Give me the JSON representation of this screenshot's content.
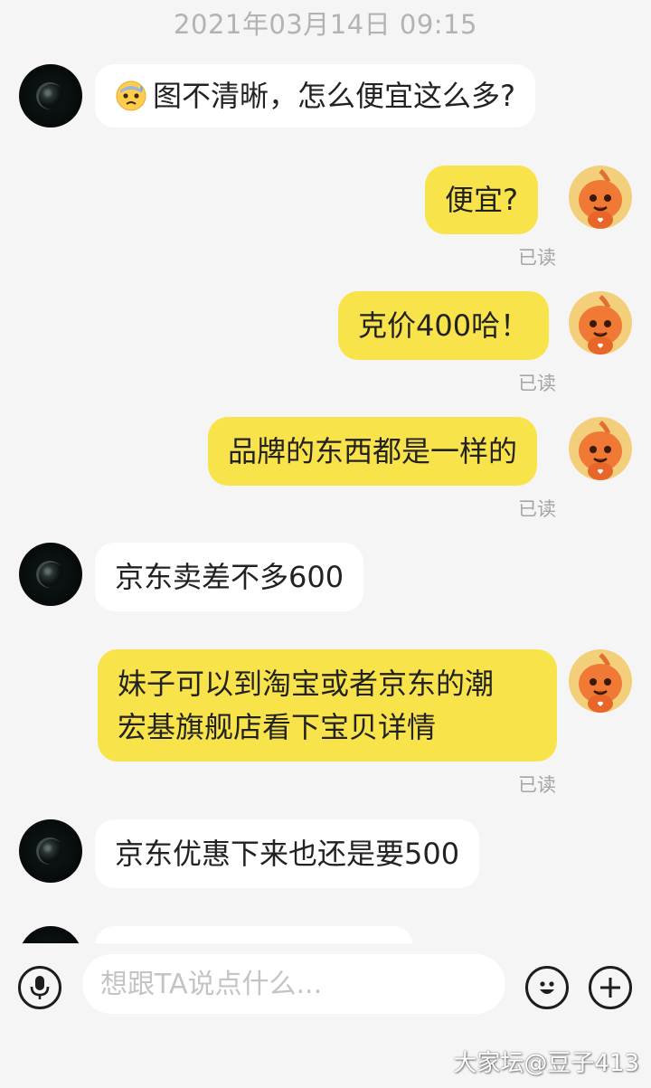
{
  "header": {
    "timestamp": "2021年03月14日  09:15"
  },
  "messages": [
    {
      "side": "left",
      "text": "图不清晰，怎么便宜这么多?",
      "emoji": "anxious-sweat-face"
    },
    {
      "side": "right",
      "text": "便宜?",
      "status": "已读"
    },
    {
      "side": "right",
      "text": "克价400哈！",
      "status": "已读"
    },
    {
      "side": "right",
      "text": "品牌的东西都是一样的",
      "status": "已读"
    },
    {
      "side": "left",
      "text": "京东卖差不多600"
    },
    {
      "side": "right",
      "lines": [
        "妹子可以到淘宝或者京东的潮",
        "宏基旗舰店看下宝贝详情"
      ],
      "status": "已读"
    },
    {
      "side": "left",
      "text": "京东优惠下来也还是要500"
    }
  ],
  "input": {
    "placeholder": "想跟TA说点什么..."
  },
  "watermark": "大家坛@豆子413",
  "colors": {
    "self_bubble": "#f8e34b",
    "other_bubble": "#ffffff",
    "background": "#f5f5f5"
  }
}
